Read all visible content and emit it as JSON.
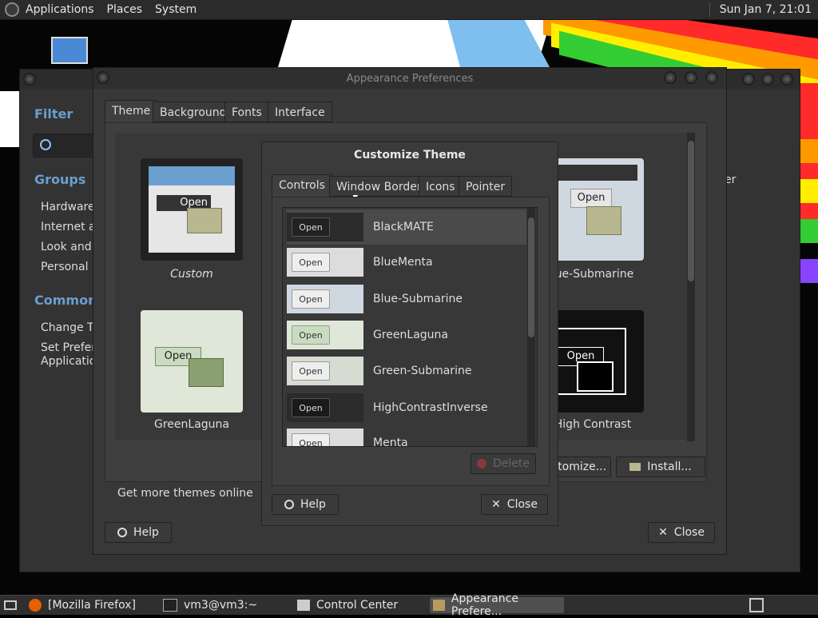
{
  "top_panel": {
    "menus": [
      "Applications",
      "Places",
      "System"
    ],
    "clock": "Sun Jan  7, 21:01"
  },
  "taskbar": {
    "tasks": [
      "[Mozilla Firefox]",
      "vm3@vm3:~",
      "Control Center",
      "Appearance Prefere..."
    ]
  },
  "control_center": {
    "filter_label": "Filter",
    "groups_label": "Groups",
    "groups": [
      "Hardware",
      "Internet an",
      "Look and F",
      "Personal"
    ],
    "common_label": "Common T",
    "common": [
      "Change Th",
      "Set Preferre",
      "Application"
    ],
    "right_fragment": "er"
  },
  "appearance": {
    "title": "Appearance Preferences",
    "tabs": [
      "Theme",
      "Background",
      "Fonts",
      "Interface"
    ],
    "themes": [
      "Custom",
      "GreenLaguna",
      "lue-Submarine",
      "High Contrast"
    ],
    "thumb_open": "Open",
    "get_more": "Get more themes online",
    "customize_label": "stomize...",
    "install_label": "Install...",
    "help_label": "Help",
    "close_label": "Close"
  },
  "customize": {
    "title": "Customize Theme",
    "tabs": [
      "Controls",
      "Window Border",
      "Icons",
      "Pointer"
    ],
    "preview_button": "Open",
    "themes": [
      "BlackMATE",
      "BlueMenta",
      "Blue-Submarine",
      "GreenLaguna",
      "Green-Submarine",
      "HighContrastInverse",
      "Menta"
    ],
    "delete_label": "Delete",
    "help_label": "Help",
    "close_label": "Close"
  },
  "colors": {
    "selected_row": "#4a4a4a",
    "accent_blue": "#6a9fd0"
  }
}
